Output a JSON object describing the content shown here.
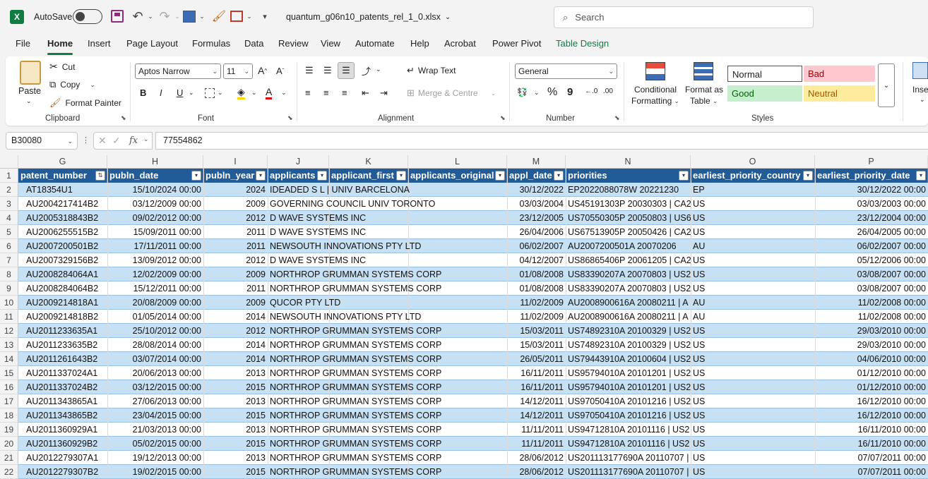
{
  "titlebar": {
    "autosave_label": "AutoSave",
    "autosave_state": "Off",
    "filename": "quantum_g06n10_patents_rel_1_0.xlsx",
    "search_placeholder": "Search"
  },
  "menu": [
    "File",
    "Home",
    "Insert",
    "Page Layout",
    "Formulas",
    "Data",
    "Review",
    "View",
    "Automate",
    "Help",
    "Acrobat",
    "Power Pivot",
    "Table Design"
  ],
  "ribbon": {
    "clipboard": {
      "paste": "Paste",
      "cut": "Cut",
      "copy": "Copy",
      "format_painter": "Format Painter",
      "label": "Clipboard"
    },
    "font": {
      "name": "Aptos Narrow",
      "size": "11",
      "bold": "B",
      "italic": "I",
      "underline": "U",
      "label": "Font"
    },
    "alignment": {
      "wrap": "Wrap Text",
      "merge": "Merge & Centre",
      "label": "Alignment"
    },
    "number": {
      "format": "General",
      "percent": "%",
      "comma": "9",
      "label": "Number"
    },
    "styles": {
      "conditional_1": "Conditional",
      "conditional_2": "Formatting",
      "format_table_1": "Format as",
      "format_table_2": "Table",
      "normal": "Normal",
      "bad": "Bad",
      "good": "Good",
      "neutral": "Neutral",
      "label": "Styles"
    },
    "insert_partial": "Inse"
  },
  "formula_bar": {
    "name_box": "B30080",
    "value": "77554862",
    "fx": "fx"
  },
  "columns": [
    "G",
    "H",
    "I",
    "J",
    "K",
    "L",
    "M",
    "N",
    "O",
    "P"
  ],
  "headers": [
    "patent_number",
    "publn_date",
    "publn_year",
    "applicants",
    "applicant_first",
    "applicants_original",
    "appl_date",
    "priorities",
    "earliest_priority_country",
    "earliest_priority_date"
  ],
  "row_numbers": [
    "1",
    "2",
    "3",
    "4",
    "5",
    "6",
    "7",
    "8",
    "9",
    "10",
    "11",
    "12",
    "13",
    "14",
    "15",
    "16",
    "17",
    "18",
    "19",
    "20",
    "21",
    "22"
  ],
  "rows": [
    [
      "AT18354U1",
      "15/10/2024 00:00",
      "2024",
      "IDEADED S L | UNIV BARCELONA",
      "",
      "",
      "30/12/2022",
      "EP2022088078W 20221230",
      "EP",
      "30/12/2022 00:00"
    ],
    [
      "AU2004217414B2",
      "03/12/2009 00:00",
      "2009",
      "GOVERNING COUNCIL UNIV TORONTO",
      "",
      "",
      "03/03/2004",
      "US45191303P 20030303 | CA2",
      "US",
      "03/03/2003 00:00"
    ],
    [
      "AU2005318843B2",
      "09/02/2012 00:00",
      "2012",
      "D WAVE SYSTEMS INC",
      "",
      "",
      "23/12/2005",
      "US70550305P 20050803 | US6",
      "US",
      "23/12/2004 00:00"
    ],
    [
      "AU2006255515B2",
      "15/09/2011 00:00",
      "2011",
      "D WAVE SYSTEMS INC",
      "",
      "",
      "26/04/2006",
      "US67513905P 20050426 | CA2",
      "US",
      "26/04/2005 00:00"
    ],
    [
      "AU2007200501B2",
      "17/11/2011 00:00",
      "2011",
      "NEWSOUTH INNOVATIONS PTY LTD",
      "",
      "",
      "06/02/2007",
      "AU2007200501A 20070206",
      "AU",
      "06/02/2007 00:00"
    ],
    [
      "AU2007329156B2",
      "13/09/2012 00:00",
      "2012",
      "D WAVE SYSTEMS INC",
      "",
      "",
      "04/12/2007",
      "US86865406P 20061205 | CA2",
      "US",
      "05/12/2006 00:00"
    ],
    [
      "AU2008284064A1",
      "12/02/2009 00:00",
      "2009",
      "NORTHROP GRUMMAN SYSTEMS CORP",
      "",
      "",
      "01/08/2008",
      "US83390207A 20070803 | US2",
      "US",
      "03/08/2007 00:00"
    ],
    [
      "AU2008284064B2",
      "15/12/2011 00:00",
      "2011",
      "NORTHROP GRUMMAN SYSTEMS CORP",
      "",
      "",
      "01/08/2008",
      "US83390207A 20070803 | US2",
      "US",
      "03/08/2007 00:00"
    ],
    [
      "AU2009214818A1",
      "20/08/2009 00:00",
      "2009",
      "QUCOR PTY LTD",
      "",
      "",
      "11/02/2009",
      "AU2008900616A 20080211 | A",
      "AU",
      "11/02/2008 00:00"
    ],
    [
      "AU2009214818B2",
      "01/05/2014 00:00",
      "2014",
      "NEWSOUTH INNOVATIONS PTY LTD",
      "",
      "",
      "11/02/2009",
      "AU2008900616A 20080211 | A",
      "AU",
      "11/02/2008 00:00"
    ],
    [
      "AU2011233635A1",
      "25/10/2012 00:00",
      "2012",
      "NORTHROP GRUMMAN SYSTEMS CORP",
      "",
      "",
      "15/03/2011",
      "US74892310A 20100329 | US2",
      "US",
      "29/03/2010 00:00"
    ],
    [
      "AU2011233635B2",
      "28/08/2014 00:00",
      "2014",
      "NORTHROP GRUMMAN SYSTEMS CORP",
      "",
      "",
      "15/03/2011",
      "US74892310A 20100329 | US2",
      "US",
      "29/03/2010 00:00"
    ],
    [
      "AU2011261643B2",
      "03/07/2014 00:00",
      "2014",
      "NORTHROP GRUMMAN SYSTEMS CORP",
      "",
      "",
      "26/05/2011",
      "US79443910A 20100604 | US2",
      "US",
      "04/06/2010 00:00"
    ],
    [
      "AU2011337024A1",
      "20/06/2013 00:00",
      "2013",
      "NORTHROP GRUMMAN SYSTEMS CORP",
      "",
      "",
      "16/11/2011",
      "US95794010A 20101201 | US2",
      "US",
      "01/12/2010 00:00"
    ],
    [
      "AU2011337024B2",
      "03/12/2015 00:00",
      "2015",
      "NORTHROP GRUMMAN SYSTEMS CORP",
      "",
      "",
      "16/11/2011",
      "US95794010A 20101201 | US2",
      "US",
      "01/12/2010 00:00"
    ],
    [
      "AU2011343865A1",
      "27/06/2013 00:00",
      "2013",
      "NORTHROP GRUMMAN SYSTEMS CORP",
      "",
      "",
      "14/12/2011",
      "US97050410A 20101216 | US2",
      "US",
      "16/12/2010 00:00"
    ],
    [
      "AU2011343865B2",
      "23/04/2015 00:00",
      "2015",
      "NORTHROP GRUMMAN SYSTEMS CORP",
      "",
      "",
      "14/12/2011",
      "US97050410A 20101216 | US2",
      "US",
      "16/12/2010 00:00"
    ],
    [
      "AU2011360929A1",
      "21/03/2013 00:00",
      "2013",
      "NORTHROP GRUMMAN SYSTEMS CORP",
      "",
      "",
      "11/11/2011",
      "US94712810A 20101116 | US2",
      "US",
      "16/11/2010 00:00"
    ],
    [
      "AU2011360929B2",
      "05/02/2015 00:00",
      "2015",
      "NORTHROP GRUMMAN SYSTEMS CORP",
      "",
      "",
      "11/11/2011",
      "US94712810A 20101116 | US2",
      "US",
      "16/11/2010 00:00"
    ],
    [
      "AU2012279307A1",
      "19/12/2013 00:00",
      "2013",
      "NORTHROP GRUMMAN SYSTEMS CORP",
      "",
      "",
      "28/06/2012",
      "US201113177690A 20110707 |",
      "US",
      "07/07/2011 00:00"
    ],
    [
      "AU2012279307B2",
      "19/02/2015 00:00",
      "2015",
      "NORTHROP GRUMMAN SYSTEMS CORP",
      "",
      "",
      "28/06/2012",
      "US201113177690A 20110707 |",
      "US",
      "07/07/2011 00:00"
    ]
  ],
  "colors": {
    "accent": "#107c41",
    "table_header": "#215c98",
    "band": "#c6e0f4"
  }
}
